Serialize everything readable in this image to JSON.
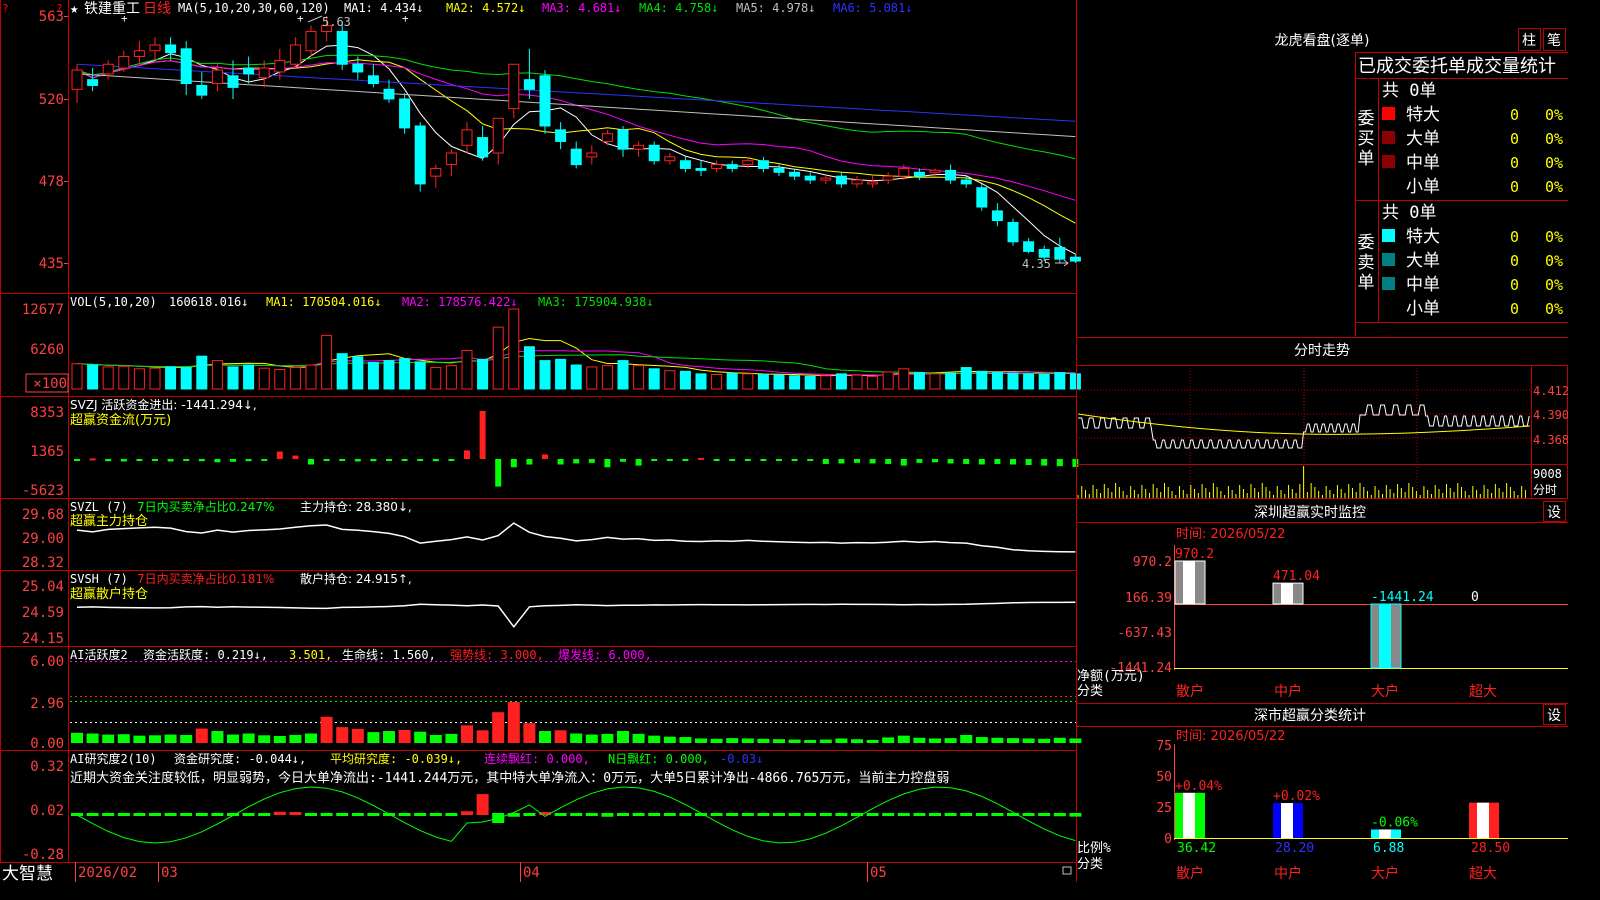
{
  "stock": {
    "name": "铁建重工",
    "period": "日线",
    "star": "★"
  },
  "colors": {
    "up": "#ff2020",
    "down": "#00ffff",
    "frame": "#c00000",
    "axis": "#ff4040",
    "ma1": "#ffffff",
    "ma2": "#ffff00",
    "ma3": "#ff00ff",
    "ma4": "#00e000",
    "ma5": "#c0c0c0",
    "ma6": "#3030ff",
    "green": "#00ff00",
    "yellow": "#ffff00",
    "cyan": "#00ffff"
  },
  "price_panel": {
    "legend": {
      "ma_label": "MA(5,10,20,30,60,120)",
      "ma1": "MA1: 4.434↓",
      "ma2": "MA2: 4.572↓",
      "ma3": "MA3: 4.681↓",
      "ma4": "MA4: 4.758↓",
      "ma5": "MA5: 4.978↓",
      "ma6": "MA6: 5.081↓"
    },
    "y_ticks": [
      "563",
      "520",
      "478",
      "435"
    ],
    "high_label": "5.63",
    "low_label": "4.35"
  },
  "volume_panel": {
    "legend": {
      "label": "VOL(5,10,20)",
      "value": "160618.016↓",
      "ma1": "MA1: 170504.016↓",
      "ma2": "MA2: 178576.422↓",
      "ma3": "MA3: 175904.938↓"
    },
    "y_ticks": [
      "12677",
      "6260",
      "×100"
    ]
  },
  "svzj_panel": {
    "line1": "SVZJ  活跃资金进出: -1441.294↓,",
    "line2": "超赢资金流(万元)",
    "y_ticks": [
      "8353",
      "1365",
      "-5623"
    ]
  },
  "svzl_panel": {
    "label": "SVZL (7)",
    "ratio": "7日内买卖净占比0.247%",
    "holding": "主力持仓: 28.380↓,",
    "line2": "超赢主力持仓",
    "y_ticks": [
      "29.68",
      "29.00",
      "28.32"
    ]
  },
  "svsh_panel": {
    "label": "SVSH (7)",
    "ratio": "7日内买卖净占比0.181%",
    "holding": "散户持仓: 24.915↑,",
    "line2": "超赢散户持仓",
    "y_ticks": [
      "25.04",
      "24.59",
      "24.15"
    ]
  },
  "ai_active_panel": {
    "label": "AI活跃度2",
    "activity": "资金活跃度: 0.219↓,",
    "v2": "3.501,",
    "life": "生命线: 1.560,",
    "strong": "强势线: 3.000,",
    "burst": "爆发线: 6.000,",
    "y_ticks": [
      "6.00",
      "2.96",
      "0.00"
    ]
  },
  "ai_research_panel": {
    "label": "AI研究度2(10)",
    "research": "资金研究度: -0.044↓,",
    "avg": "平均研究度: -0.039↓,",
    "streak": "连续飘红: 0.000,",
    "n_red": "N日飘红: 0.000,",
    "last": "-0.03↓",
    "comment": "近期大资金关注度较低，明显弱势，今日大单净流出:-1441.244万元，其中特大单净流入：0万元，大单5日累计净出-4866.765万元，当前主力控盘弱",
    "y_ticks": [
      "0.32",
      "0.02",
      "-0.28"
    ]
  },
  "x_axis": {
    "labels": [
      "2026/02",
      "03",
      "04",
      "05"
    ],
    "brand": "大智慧"
  },
  "right": {
    "dragon": {
      "title": "龙虎看盘(逐单)",
      "btn_col": "柱",
      "btn_pen": "笔",
      "header": "已成交委托单成交量统计"
    },
    "buy": {
      "side": "委买单",
      "total": "共 0单",
      "rows": [
        {
          "name": "特大",
          "qty": "0",
          "pct": "0%"
        },
        {
          "name": "大单",
          "qty": "0",
          "pct": "0%"
        },
        {
          "name": "中单",
          "qty": "0",
          "pct": "0%"
        },
        {
          "name": "小单",
          "qty": "0",
          "pct": "0%"
        }
      ]
    },
    "sell": {
      "side": "委卖单",
      "total": "共 0单",
      "rows": [
        {
          "name": "特大",
          "qty": "0",
          "pct": "0%"
        },
        {
          "name": "大单",
          "qty": "0",
          "pct": "0%"
        },
        {
          "name": "中单",
          "qty": "0",
          "pct": "0%"
        },
        {
          "name": "小单",
          "qty": "0",
          "pct": "0%"
        }
      ]
    },
    "intraday": {
      "title": "分时走势",
      "y_ticks": [
        "4.412",
        "4.390",
        "4.368"
      ],
      "vol_top": "9008",
      "vol_unit": "分时"
    },
    "monitor": {
      "title": "深圳超赢实时监控",
      "set": "设",
      "time": "时间: 2026/05/22",
      "y_ticks": [
        "970.2",
        "166.39",
        "-637.43",
        "-1441.24"
      ],
      "bar_labels": [
        "970.2",
        "471.04",
        "-1441.24",
        "0"
      ],
      "y_unit": "净额(万元)",
      "x_unit": "分类",
      "categories": [
        "散户",
        "中户",
        "大户",
        "超大"
      ]
    },
    "classify": {
      "title": "深市超赢分类统计",
      "set": "设",
      "time": "时间: 2026/05/22",
      "y_ticks": [
        "75",
        "50",
        "25",
        "0"
      ],
      "changes": [
        "+0.04%",
        "+0.02%",
        "-0.06%",
        ""
      ],
      "values": [
        "36.42",
        "28.20",
        "6.88",
        "28.50"
      ],
      "y_unit": "比例%",
      "x_unit": "分类",
      "categories": [
        "散户",
        "中户",
        "大户",
        "超大"
      ]
    }
  },
  "chart_data": {
    "type": "candlestick",
    "x_labels": [
      "2026/02",
      "03",
      "04",
      "05"
    ],
    "price_range": [
      4.35,
      5.63
    ],
    "candles": [
      [
        5.25,
        5.38,
        5.18,
        5.35
      ],
      [
        5.3,
        5.36,
        5.24,
        5.27
      ],
      [
        5.33,
        5.4,
        5.3,
        5.38
      ],
      [
        5.36,
        5.45,
        5.34,
        5.42
      ],
      [
        5.42,
        5.5,
        5.38,
        5.45
      ],
      [
        5.45,
        5.52,
        5.4,
        5.48
      ],
      [
        5.48,
        5.52,
        5.4,
        5.44
      ],
      [
        5.46,
        5.5,
        5.22,
        5.28
      ],
      [
        5.27,
        5.34,
        5.2,
        5.22
      ],
      [
        5.28,
        5.38,
        5.24,
        5.35
      ],
      [
        5.32,
        5.4,
        5.2,
        5.26
      ],
      [
        5.36,
        5.42,
        5.28,
        5.33
      ],
      [
        5.31,
        5.4,
        5.26,
        5.36
      ],
      [
        5.34,
        5.46,
        5.3,
        5.4
      ],
      [
        5.38,
        5.52,
        5.36,
        5.48
      ],
      [
        5.45,
        5.58,
        5.42,
        5.55
      ],
      [
        5.55,
        5.63,
        5.5,
        5.58
      ],
      [
        5.55,
        5.6,
        5.35,
        5.38
      ],
      [
        5.38,
        5.42,
        5.3,
        5.34
      ],
      [
        5.32,
        5.38,
        5.26,
        5.28
      ],
      [
        5.25,
        5.3,
        5.18,
        5.2
      ],
      [
        5.2,
        5.23,
        5.02,
        5.05
      ],
      [
        5.06,
        5.08,
        4.72,
        4.76
      ],
      [
        4.8,
        4.86,
        4.74,
        4.84
      ],
      [
        4.86,
        4.94,
        4.8,
        4.92
      ],
      [
        4.96,
        5.08,
        4.92,
        5.04
      ],
      [
        5.0,
        5.06,
        4.88,
        4.9
      ],
      [
        4.92,
        5.1,
        4.86,
        5.1
      ],
      [
        5.15,
        5.38,
        5.1,
        5.38
      ],
      [
        5.3,
        5.46,
        5.2,
        5.25
      ],
      [
        5.32,
        5.35,
        5.02,
        5.06
      ],
      [
        5.04,
        5.08,
        4.94,
        4.98
      ],
      [
        4.94,
        4.98,
        4.84,
        4.86
      ],
      [
        4.9,
        4.96,
        4.86,
        4.92
      ],
      [
        4.98,
        5.04,
        4.96,
        5.02
      ],
      [
        5.04,
        5.06,
        4.9,
        4.94
      ],
      [
        4.94,
        4.98,
        4.9,
        4.96
      ],
      [
        4.96,
        4.98,
        4.86,
        4.88
      ],
      [
        4.88,
        4.92,
        4.86,
        4.9
      ],
      [
        4.88,
        4.9,
        4.82,
        4.84
      ],
      [
        4.84,
        4.88,
        4.8,
        4.83
      ],
      [
        4.84,
        4.88,
        4.82,
        4.86
      ],
      [
        4.86,
        4.88,
        4.82,
        4.84
      ],
      [
        4.86,
        4.9,
        4.84,
        4.88
      ],
      [
        4.88,
        4.9,
        4.82,
        4.84
      ],
      [
        4.84,
        4.86,
        4.8,
        4.82
      ],
      [
        4.82,
        4.84,
        4.78,
        4.8
      ],
      [
        4.8,
        4.82,
        4.76,
        4.78
      ],
      [
        4.78,
        4.8,
        4.76,
        4.79
      ],
      [
        4.8,
        4.82,
        4.74,
        4.76
      ],
      [
        4.76,
        4.8,
        4.74,
        4.78
      ],
      [
        4.76,
        4.8,
        4.74,
        4.77
      ],
      [
        4.78,
        4.82,
        4.76,
        4.8
      ],
      [
        4.8,
        4.86,
        4.78,
        4.84
      ],
      [
        4.82,
        4.84,
        4.78,
        4.8
      ],
      [
        4.82,
        4.84,
        4.8,
        4.83
      ],
      [
        4.83,
        4.86,
        4.76,
        4.78
      ],
      [
        4.78,
        4.8,
        4.74,
        4.76
      ],
      [
        4.74,
        4.76,
        4.62,
        4.64
      ],
      [
        4.62,
        4.66,
        4.54,
        4.57
      ],
      [
        4.56,
        4.58,
        4.44,
        4.46
      ],
      [
        4.46,
        4.48,
        4.4,
        4.41
      ],
      [
        4.42,
        4.44,
        4.36,
        4.38
      ],
      [
        4.43,
        4.48,
        4.35,
        4.37
      ],
      [
        4.38,
        4.4,
        4.35,
        4.36
      ]
    ],
    "volume_series_x100": [
      4000,
      3800,
      3500,
      3600,
      3200,
      3300,
      3500,
      3400,
      5200,
      4500,
      3500,
      3800,
      3300,
      3100,
      3400,
      3800,
      8500,
      5600,
      5100,
      4200,
      4500,
      4800,
      4300,
      3400,
      3700,
      6100,
      4700,
      9800,
      12677,
      6700,
      4500,
      4700,
      3800,
      3500,
      3700,
      4500,
      3700,
      3200,
      2900,
      2800,
      2400,
      2300,
      2500,
      2400,
      2300,
      2200,
      2100,
      2000,
      2100,
      2400,
      2200,
      2000,
      2700,
      3200,
      2600,
      2400,
      2500,
      3400,
      2800,
      2600,
      2500,
      2400,
      2300,
      2600,
      2400
    ],
    "fund_flow_series_wan": [
      -50,
      100,
      -400,
      -450,
      -350,
      -300,
      -450,
      -350,
      -400,
      -600,
      -500,
      -400,
      -350,
      1300,
      600,
      -1000,
      -200,
      -350,
      -450,
      -400,
      -350,
      -300,
      -250,
      -400,
      -350,
      1500,
      8353,
      -5000,
      -1500,
      -1000,
      800,
      -1000,
      -800,
      -700,
      -1500,
      -500,
      -1200,
      -300,
      -200,
      -200,
      200,
      -200,
      -100,
      -200,
      -150,
      -100,
      -200,
      -150,
      -900,
      -800,
      -700,
      -800,
      -900,
      -1200,
      -700,
      -600,
      -800,
      -900,
      -1000,
      -900,
      -1000,
      -1100,
      -1200,
      -1300,
      -1441
    ]
  }
}
